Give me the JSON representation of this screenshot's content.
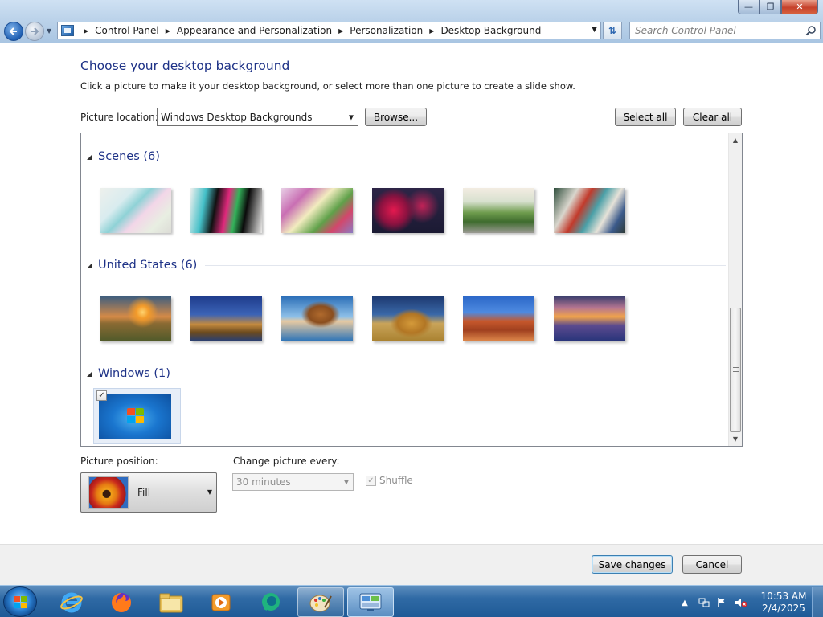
{
  "window": {
    "breadcrumb": [
      "Control Panel",
      "Appearance and Personalization",
      "Personalization",
      "Desktop Background"
    ],
    "search_placeholder": "Search Control Panel"
  },
  "page": {
    "title": "Choose your desktop background",
    "subtitle": "Click a picture to make it your desktop background, or select more than one picture to create a slide show."
  },
  "picture_location": {
    "label": "Picture location:",
    "value": "Windows Desktop Backgrounds",
    "browse_label": "Browse...",
    "select_all_label": "Select all",
    "clear_all_label": "Clear all"
  },
  "groups": [
    {
      "name": "Scenes (6)",
      "items": 6,
      "theme": "abstract-art"
    },
    {
      "name": "United States (6)",
      "items": 6,
      "theme": "landscape-photos"
    },
    {
      "name": "Windows (1)",
      "items": 1,
      "selected": [
        0
      ]
    }
  ],
  "picture_position": {
    "label": "Picture position:",
    "value": "Fill"
  },
  "change_picture": {
    "label": "Change picture every:",
    "value": "30 minutes",
    "enabled": false
  },
  "shuffle": {
    "label": "Shuffle",
    "checked": true,
    "enabled": false
  },
  "footer": {
    "save_label": "Save changes",
    "cancel_label": "Cancel"
  },
  "taskbar": {
    "apps": [
      "internet-explorer-icon",
      "firefox-icon",
      "file-explorer-icon",
      "media-player-icon",
      "chat-icon",
      "personalization-icon",
      "control-panel-icon"
    ],
    "time": "10:53 AM",
    "date": "2/4/2025"
  },
  "colors": {
    "accent_title": "#1e3287",
    "taskbar": "#2f6aa5"
  }
}
